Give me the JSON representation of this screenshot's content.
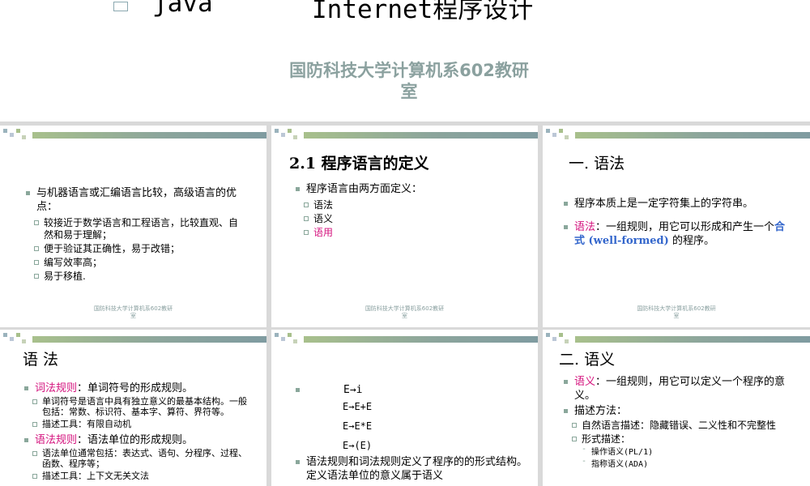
{
  "header": {
    "title_left": "java",
    "title_right": "Internet程序设计",
    "subtitle_line1": "国防科技大学计算机系602教研",
    "subtitle_line2": "室"
  },
  "footer": {
    "line1": "国防科技大学计算机系602教研",
    "line2": "室"
  },
  "slide1": {
    "bullet": "与机器语言或汇编语言比较，高级语言的优点：",
    "items": [
      "较接近于数学语言和工程语言，比较直观、自然和易于理解；",
      "便于验证其正确性，易于改错；",
      "编写效率高；",
      "易于移植."
    ]
  },
  "slide2": {
    "title": "2.1  程序语言的定义",
    "bullet": "程序语言由两方面定义：",
    "items": [
      "语法",
      "语义",
      "语用"
    ]
  },
  "slide3": {
    "title": "一. 语法",
    "bullet1": "程序本质上是一定字符集上的字符串。",
    "bullet2_term": "语法",
    "bullet2_text": "：一组规则，用它可以形成和产生一个",
    "bullet2_term2": "合式 (well-formed)",
    "bullet2_end": "的程序。"
  },
  "slide4": {
    "title": "语  法",
    "lex_term": "词法规则",
    "lex_text": "：单词符号的形成规则。",
    "lex_items": [
      "单词符号是语言中具有独立意义的最基本结构。一般包括：常数、标识符、基本字、算符、界符等。",
      "描述工具：有限自动机"
    ],
    "syn_term": "语法规则",
    "syn_text": "：语法单位的形成规则。",
    "syn_items": [
      "语法单位通常包括：表达式、语句、分程序、过程、函数、程序等；",
      "描述工具：上下文无关文法"
    ]
  },
  "slide5": {
    "productions": [
      "E→i",
      "E→E+E",
      "E→E*E",
      "E→(E)"
    ],
    "bullet": "语法规则和词法规则定义了程序的的形式结构。定义语法单位的意义属于语义"
  },
  "slide6": {
    "title": "二. 语义",
    "b1_term": "语义",
    "b1_text": "：一组规则，用它可以定义一个程序的意义。",
    "b2": "描述方法：",
    "items": [
      "自然语言描述：隐藏错误、二义性和不完整性",
      "形式描述："
    ],
    "sub_items": [
      "操作语义(PL/1)",
      "指称语义(ADA)"
    ]
  }
}
